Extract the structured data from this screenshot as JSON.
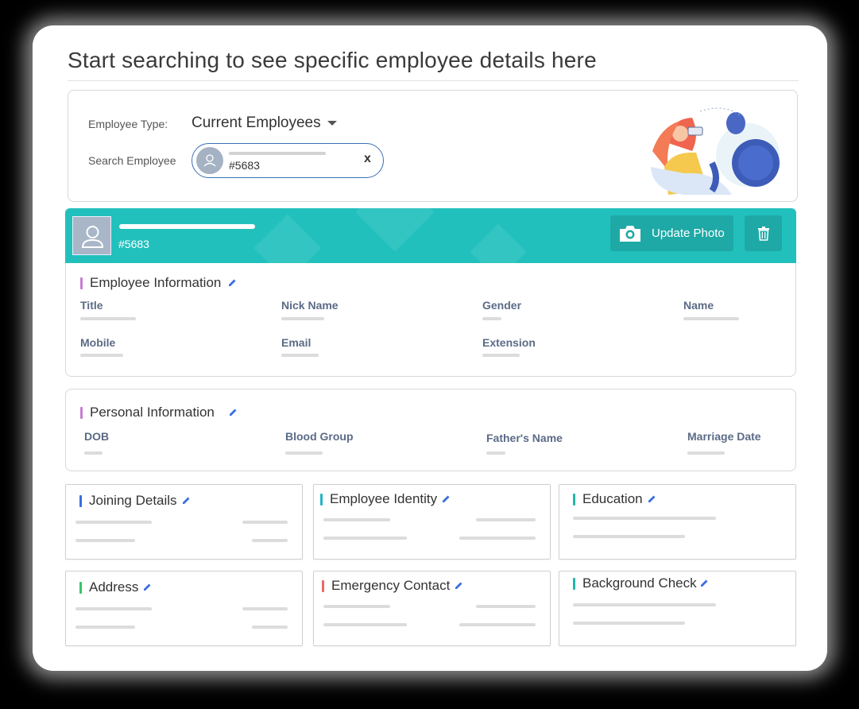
{
  "page": {
    "title": "Start searching to see specific employee details here"
  },
  "search": {
    "employee_type_label": "Employee Type:",
    "employee_type_value": "Current Employees",
    "search_label": "Search Employee",
    "search_value": "#5683",
    "clear_label": "x"
  },
  "banner": {
    "employee_id": "#5683",
    "update_photo_label": "Update Photo"
  },
  "employee_information": {
    "heading": "Employee Information",
    "fields": [
      "Title",
      "Nick Name",
      "Gender",
      "Name",
      "Mobile",
      "Email",
      "Extension"
    ]
  },
  "personal_information": {
    "heading": "Personal Information",
    "fields": [
      "DOB",
      "Blood Group",
      "Father's Name",
      "Marriage Date"
    ]
  },
  "cards": [
    {
      "heading": "Joining Details"
    },
    {
      "heading": "Employee Identity"
    },
    {
      "heading": "Education"
    },
    {
      "heading": "Address"
    },
    {
      "heading": "Emergency Contact"
    },
    {
      "heading": "Background Check"
    }
  ],
  "colors": {
    "banner": "#22c0bd",
    "button": "#1ea9a6",
    "section_mark_purple": "#c77cd0",
    "mark_blue": "#3a6fe0",
    "mark_teal": "#22b6c8",
    "mark_green": "#35c46e",
    "mark_red": "#e56a6a",
    "field_label": "#5b6b86"
  }
}
